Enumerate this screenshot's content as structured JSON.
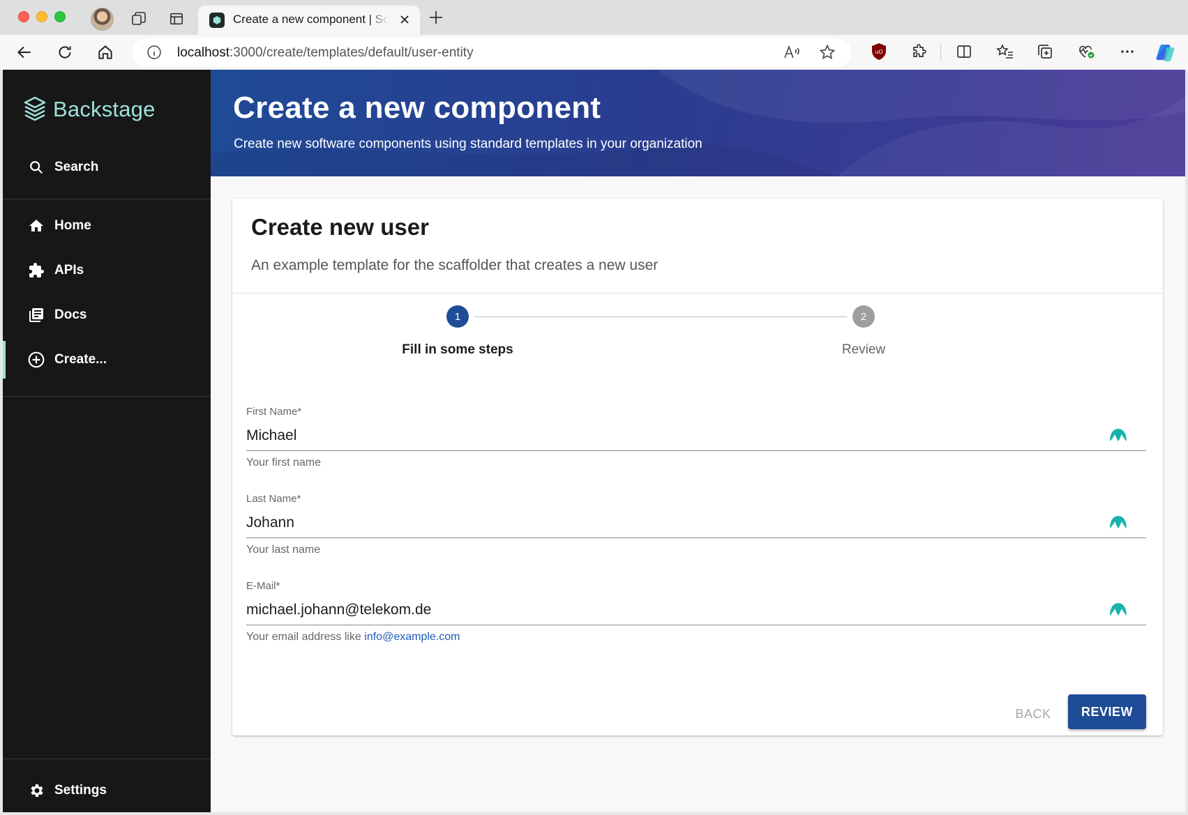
{
  "browser": {
    "tab_title": "Create a new component | Scaffolder",
    "url_host": "localhost",
    "url_path": ":3000/create/templates/default/user-entity"
  },
  "sidebar": {
    "logo_text": "Backstage",
    "search_label": "Search",
    "items": [
      {
        "label": "Home",
        "icon": "home-icon"
      },
      {
        "label": "APIs",
        "icon": "puzzle-icon"
      },
      {
        "label": "Docs",
        "icon": "library-icon"
      },
      {
        "label": "Create...",
        "icon": "add-circle-icon"
      }
    ],
    "settings_label": "Settings"
  },
  "header": {
    "title": "Create a new component",
    "subtitle": "Create new software components using standard templates in your organization"
  },
  "template": {
    "title": "Create new user",
    "description": "An example template for the scaffolder that creates a new user"
  },
  "stepper": {
    "steps": [
      {
        "number": "1",
        "label": "Fill in some steps",
        "active": true
      },
      {
        "number": "2",
        "label": "Review",
        "active": false
      }
    ]
  },
  "form": {
    "fields": [
      {
        "label": "First Name*",
        "value": "Michael",
        "help": "Your first name"
      },
      {
        "label": "Last Name*",
        "value": "Johann",
        "help": "Your last name"
      },
      {
        "label": "E-Mail*",
        "value": "michael.johann@telekom.de",
        "help": "Your email address like ",
        "help_link": "info@example.com"
      }
    ],
    "back_label": "BACK",
    "review_label": "REVIEW"
  },
  "colors": {
    "sidebar_bg": "#171717",
    "accent_teal": "#9ee2da",
    "primary": "#1f4c96",
    "step_inactive": "#9e9e9e"
  }
}
